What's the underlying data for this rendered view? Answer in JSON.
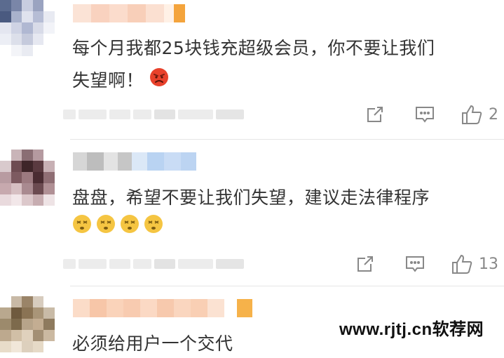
{
  "comments": [
    {
      "text_line1": "每个月我都25块钱充超级会员，你不要让我们",
      "text_line2": "失望啊！",
      "emoji_icon": "angry-face-icon",
      "share_label": "",
      "reply_label": "",
      "like_count": "2"
    },
    {
      "text_line1": "盘盘，希望不要让我们失望，建议走法律程序",
      "emoji_icon": "dizzy-face-icon",
      "share_label": "",
      "reply_label": "",
      "like_count": "13"
    },
    {
      "text_line1": "必须给用户一个交代"
    }
  ],
  "watermark": "www.rjtj.cn软荐网",
  "colors": {
    "text": "#333333",
    "action": "#888888",
    "divider": "#e6e6e6",
    "emoji_angry": "#e8412b",
    "emoji_dizzy": "#f5c542"
  }
}
